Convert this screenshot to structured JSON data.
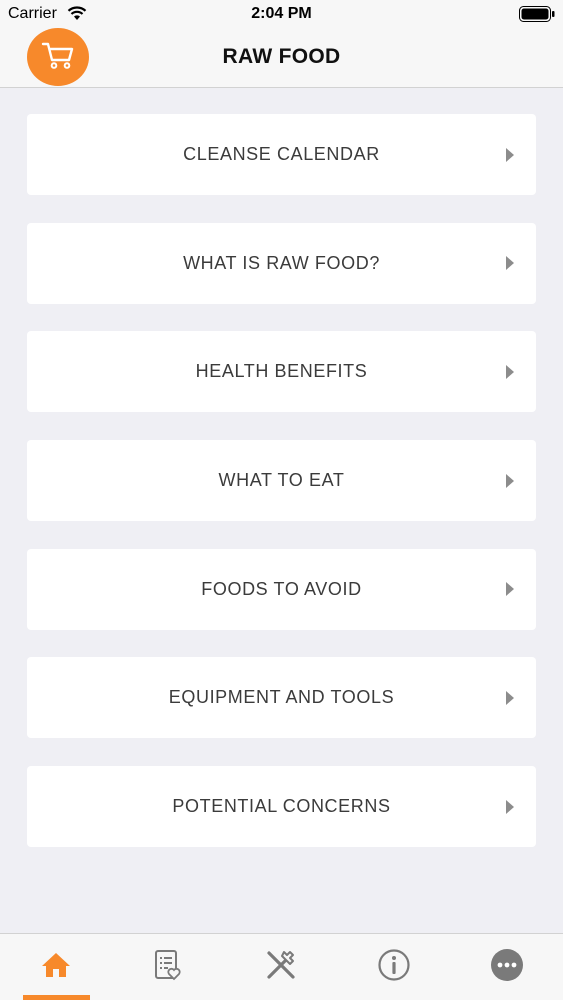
{
  "status_bar": {
    "carrier": "Carrier",
    "time": "2:04 PM"
  },
  "header": {
    "title": "RAW FOOD",
    "cart_icon": "cart-icon"
  },
  "menu": {
    "items": [
      {
        "label": "CLEANSE CALENDAR"
      },
      {
        "label": "WHAT IS RAW FOOD?"
      },
      {
        "label": "HEALTH BENEFITS"
      },
      {
        "label": "WHAT TO EAT"
      },
      {
        "label": "FOODS TO AVOID"
      },
      {
        "label": "EQUIPMENT AND TOOLS"
      },
      {
        "label": "POTENTIAL CONCERNS"
      }
    ]
  },
  "tab_bar": {
    "tabs": [
      {
        "icon": "home-icon",
        "active": true
      },
      {
        "icon": "recipe-list-icon",
        "active": false
      },
      {
        "icon": "utensils-icon",
        "active": false
      },
      {
        "icon": "info-icon",
        "active": false
      },
      {
        "icon": "more-icon",
        "active": false
      }
    ]
  },
  "colors": {
    "accent": "#f7892b",
    "background": "#efeff4",
    "card": "#ffffff",
    "icon_gray": "#7a7a7a"
  }
}
